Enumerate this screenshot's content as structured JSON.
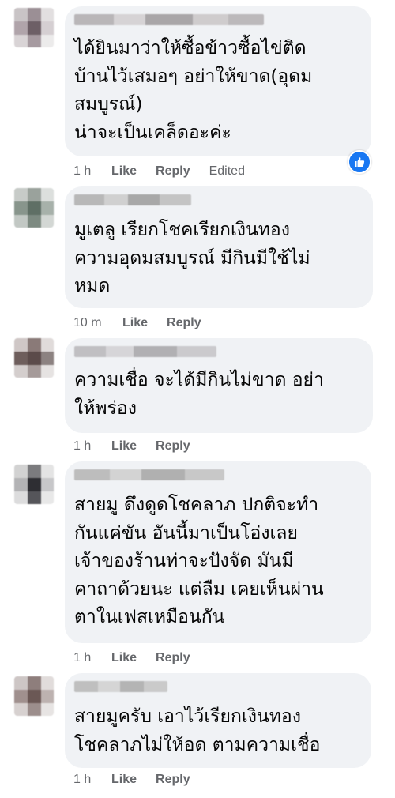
{
  "comments": [
    {
      "text": "ได้ยินมาว่าให้ซื้อข้าวซื้อไข่ติด\nบ้านไว้เสมอๆ อย่าให้ขาด(อุดม\nสมบูรณ์)\nน่าจะเป็นเคล็ดอะค่ะ",
      "time": "1 h",
      "like": "Like",
      "reply": "Reply",
      "edited": "Edited",
      "reaction": "like-icon"
    },
    {
      "text": "มูเตลู เรียกโชคเรียกเงินทอง\nความอุดมสมบูรณ์ มีกินมีใช้ไม่\nหมด",
      "time": "10 m",
      "like": "Like",
      "reply": "Reply"
    },
    {
      "text": "ความเชื่อ จะได้มีกินไม่ขาด อย่า\nให้พร่อง",
      "time": "1 h",
      "like": "Like",
      "reply": "Reply"
    },
    {
      "text": "สายมู ดึงดูดโชคลาภ ปกติจะทำ\nกันแค่ขัน อันนี้มาเป็นโอ่งเลย\nเจ้าของร้านท่าจะปังจัด มันมี\nคาถาด้วยนะ แต่ลืม เคยเห็นผ่าน\nตาในเฟสเหมือนกัน",
      "time": "1 h",
      "like": "Like",
      "reply": "Reply"
    },
    {
      "text": "สายมูครับ เอาไว้เรียกเงินทอง\nโชคลาภไม่ให้อด ตามความเชื่อ",
      "time": "1 h",
      "like": "Like",
      "reply": "Reply"
    }
  ],
  "colors": {
    "bubble": "#f0f2f5",
    "meta": "#65676b",
    "like_badge": "#1877f2"
  }
}
